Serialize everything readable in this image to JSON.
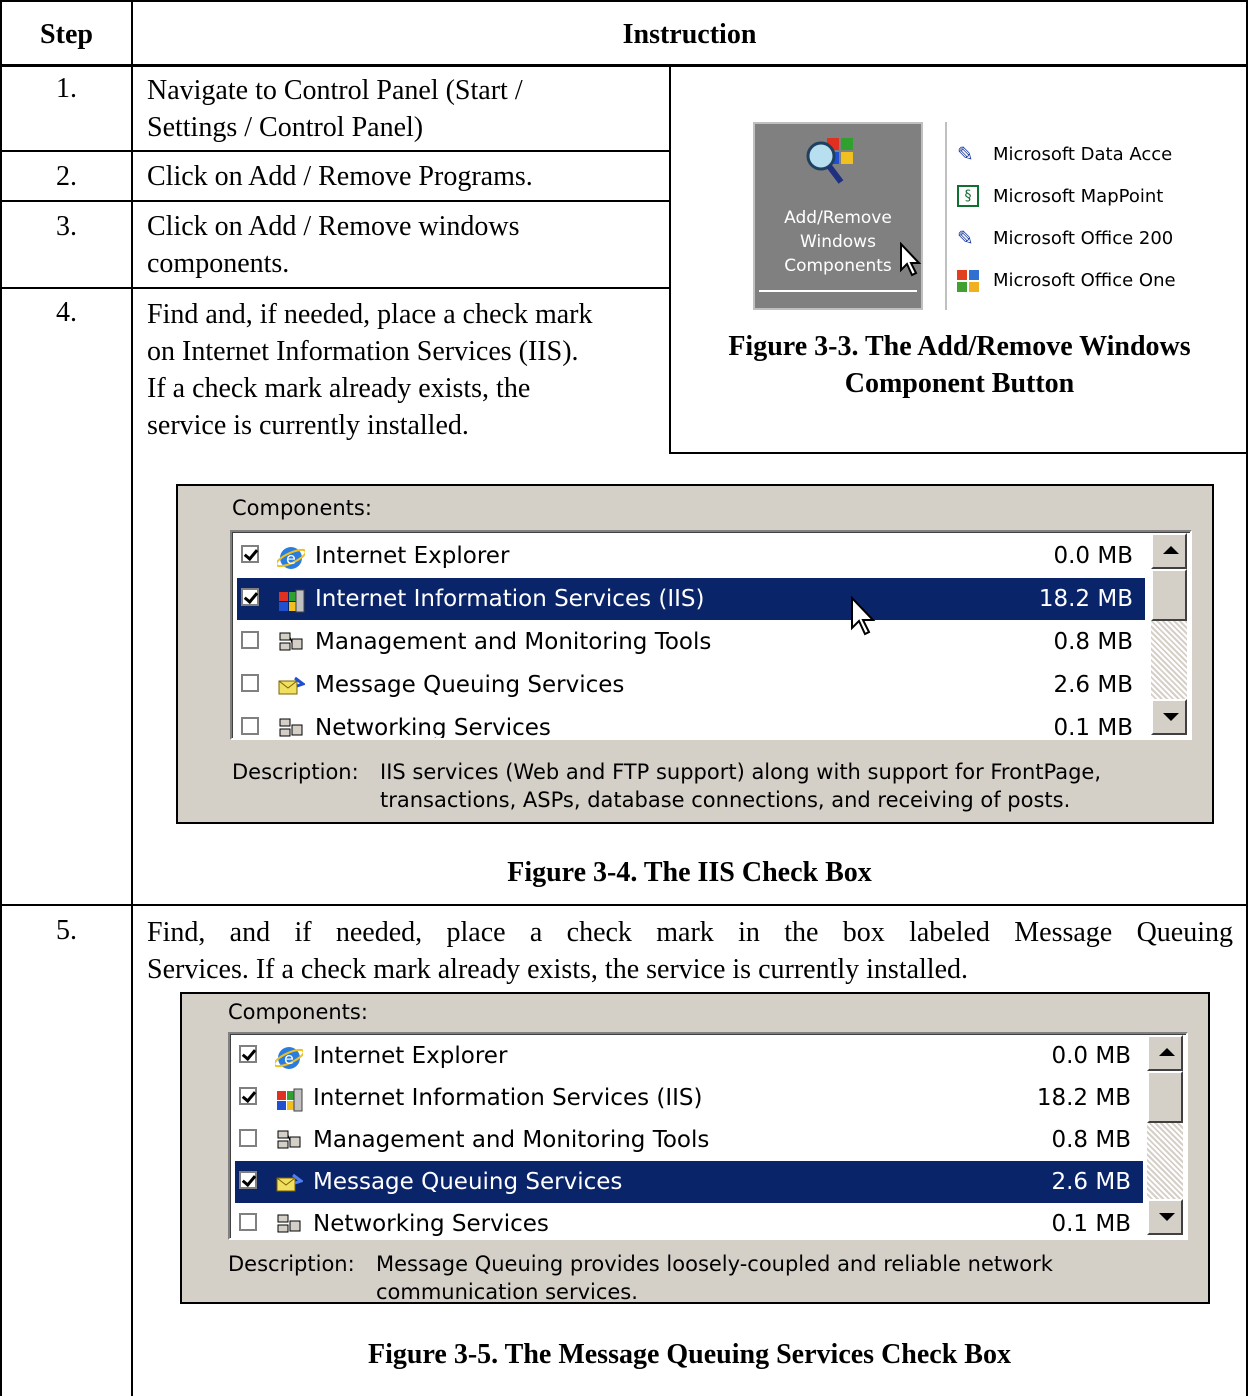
{
  "table": {
    "header_step": "Step",
    "header_instruction": "Instruction"
  },
  "steps": [
    {
      "num": "1.",
      "text_lines": [
        "Navigate to Control Panel (Start /",
        "Settings / Control Panel)"
      ]
    },
    {
      "num": "2.",
      "text_lines": [
        "Click on Add / Remove Programs."
      ]
    },
    {
      "num": "3.",
      "text_lines": [
        "Click on Add / Remove windows",
        "components."
      ]
    },
    {
      "num": "4.",
      "text_lines": [
        "Find and, if needed, place a check mark",
        "on Internet Information Services (IIS).",
        "If a check mark already exists, the",
        "service is currently installed."
      ]
    },
    {
      "num": "5.",
      "text_lines": [
        "Find, and if needed, place a check mark in the box labeled Message Queuing",
        "Services.  If a check mark already exists, the service is currently installed."
      ]
    }
  ],
  "figure33": {
    "button_label_lines": [
      "Add/Remove",
      "Windows",
      "Components"
    ],
    "list_items": [
      "Microsoft Data Acce",
      "Microsoft MapPoint",
      "Microsoft Office 200",
      "Microsoft Office One"
    ],
    "caption_lines": [
      "Figure 3-3.  The Add/Remove Windows",
      "Component Button"
    ]
  },
  "figure34": {
    "components_label": "Components:",
    "rows": [
      {
        "name": "Internet Explorer",
        "size": "0.0 MB",
        "checked": true
      },
      {
        "name": "Internet Information Services (IIS)",
        "size": "18.2 MB",
        "checked": true
      },
      {
        "name": "Management and Monitoring Tools",
        "size": "0.8 MB",
        "checked": false
      },
      {
        "name": "Message Queuing Services",
        "size": "2.6 MB",
        "checked": false
      },
      {
        "name": "Networking Services",
        "size": "0.1 MB",
        "checked": false
      }
    ],
    "selected_row": 1,
    "description_label": "Description:",
    "description_lines": [
      "IIS services (Web and FTP support) along with support for FrontPage,",
      "transactions, ASPs, database connections, and receiving of posts."
    ],
    "caption": "Figure 3-4.  The IIS Check Box"
  },
  "figure35": {
    "components_label": "Components:",
    "rows": [
      {
        "name": "Internet Explorer",
        "size": "0.0 MB",
        "checked": true
      },
      {
        "name": "Internet Information Services (IIS)",
        "size": "18.2 MB",
        "checked": true
      },
      {
        "name": "Management and Monitoring Tools",
        "size": "0.8 MB",
        "checked": false
      },
      {
        "name": "Message Queuing Services",
        "size": "2.6 MB",
        "checked": true
      },
      {
        "name": "Networking Services",
        "size": "0.1 MB",
        "checked": false
      }
    ],
    "selected_row": 3,
    "description_label": "Description:",
    "description_lines": [
      "Message Queuing provides loosely-coupled and reliable network",
      "communication services."
    ],
    "caption": "Figure 3-5.  The Message Queuing Services Check Box"
  }
}
